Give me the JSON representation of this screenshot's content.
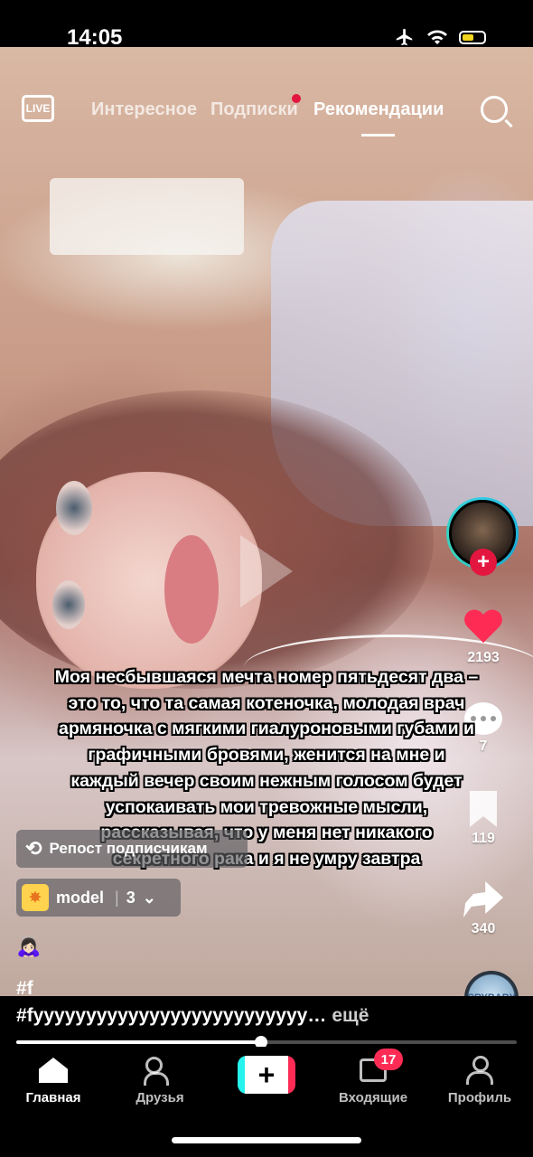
{
  "status_bar": {
    "time": "14:05",
    "battery_level": 0.55,
    "battery_color": "#f1d51e"
  },
  "top_nav": {
    "live_label": "LIVE",
    "tabs": [
      {
        "label": "Интересное",
        "active": false
      },
      {
        "label": "Подписки",
        "active": false,
        "has_dot": true
      },
      {
        "label": "Рекомендации",
        "active": true
      }
    ]
  },
  "video": {
    "caption": "Моя несбывшаяся мечта номер пятьдесят два – это то, что та самая котеночка, молодая врач армяночка с мягкими гиалуроновыми губами и графичными бровями, женится на мне и каждый вечер своим нежным голосом будет успокаивать мои тревожные мысли, рассказывая, что у меня нет никакого секретного рака и я не умру завтра",
    "repost_label": "Репост подписчикам",
    "effect": {
      "name": "model",
      "count": "3"
    },
    "emoji": "🙇🏻‍♀️",
    "hashtag_short": "#f",
    "description": "#fyyyyyyyyyyyyyyyyyyyyyyyyyy…",
    "more_label": "ещё",
    "progress": 0.49
  },
  "rail": {
    "likes": "2193",
    "comments": "7",
    "saves": "119",
    "shares": "340",
    "music_disc_label": "CRYBABY"
  },
  "bottom_nav": {
    "home": "Главная",
    "friends": "Друзья",
    "inbox": "Входящие",
    "inbox_badge": "17",
    "profile": "Профиль"
  },
  "colors": {
    "accent": "#fe2c55",
    "like": "#fe2c55",
    "story_ring": "#2ecde6"
  }
}
